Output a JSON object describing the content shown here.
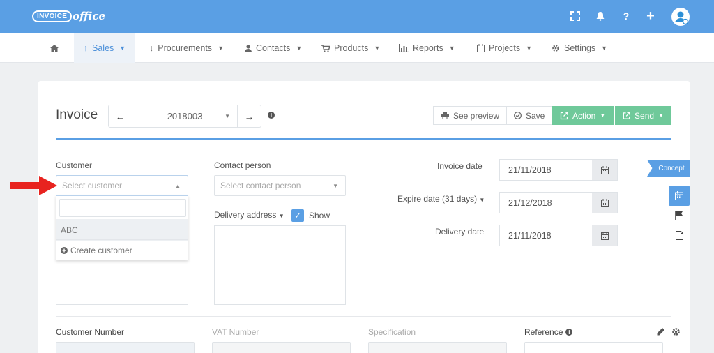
{
  "brand": {
    "badge": "INVOICE",
    "script": "office"
  },
  "topbar": {
    "help": "?",
    "plus": "+"
  },
  "nav": [
    {
      "label": "Sales"
    },
    {
      "label": "Procurements"
    },
    {
      "label": "Contacts"
    },
    {
      "label": "Products"
    },
    {
      "label": "Reports"
    },
    {
      "label": "Projects"
    },
    {
      "label": "Settings"
    }
  ],
  "invoice": {
    "title": "Invoice",
    "number": "2018003",
    "actions": {
      "preview": "See preview",
      "save": "Save",
      "action": "Action",
      "send": "Send"
    }
  },
  "form": {
    "customer_label": "Customer",
    "customer_placeholder": "Select customer",
    "dropdown": {
      "option": "ABC",
      "create": "Create customer"
    },
    "contact_label": "Contact person",
    "contact_placeholder": "Select contact person",
    "delivery_address_label": "Delivery address",
    "show_label": "Show",
    "invoice_date_label": "Invoice date",
    "invoice_date": "21/11/2018",
    "expire_date_label": "Expire date (31 days)",
    "expire_date": "21/12/2018",
    "delivery_date_label": "Delivery date",
    "delivery_date": "21/11/2018",
    "status_tag": "Concept"
  },
  "footer_fields": {
    "customer_number": "Customer Number",
    "vat_number": "VAT Number",
    "specification": "Specification",
    "reference": "Reference"
  },
  "colors": {
    "primary": "#5a9fe4",
    "green": "#6fc99a",
    "arrow": "#e8231f"
  }
}
